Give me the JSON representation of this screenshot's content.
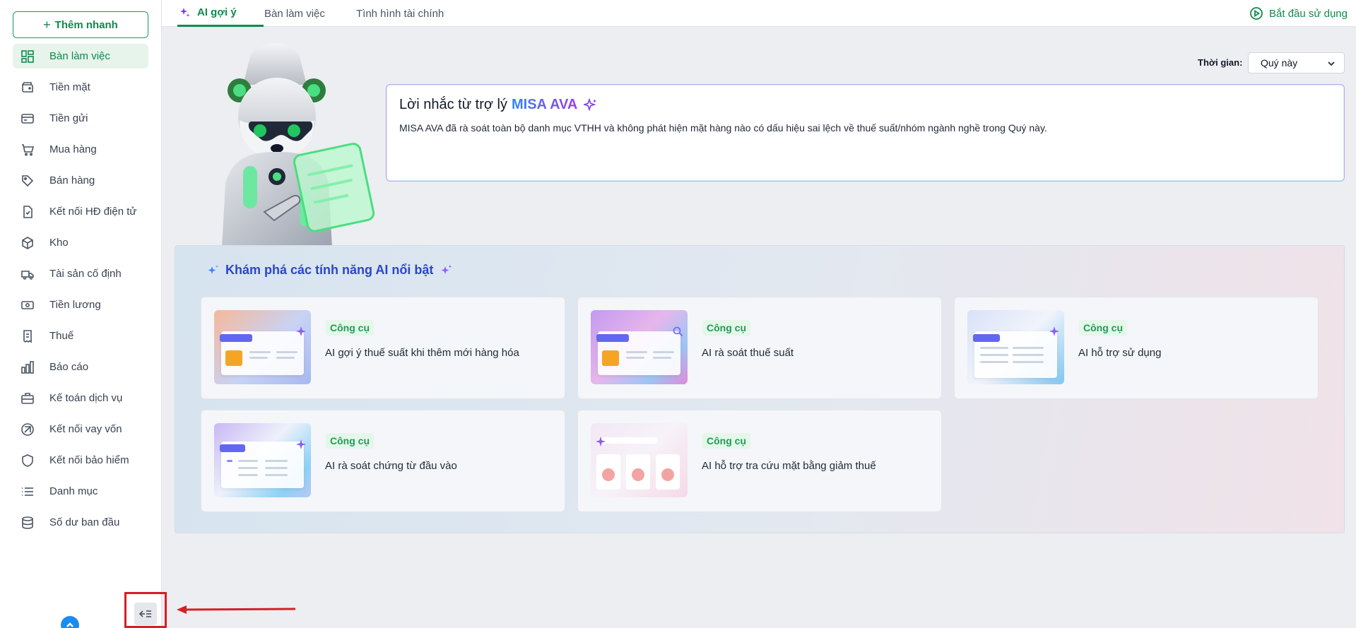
{
  "sidebar": {
    "quick_add": "Thêm nhanh",
    "items": [
      {
        "label": "Bàn làm việc",
        "icon": "dashboard-icon",
        "active": true
      },
      {
        "label": "Tiền mặt",
        "icon": "cash-icon"
      },
      {
        "label": "Tiền gửi",
        "icon": "card-icon"
      },
      {
        "label": "Mua hàng",
        "icon": "cart-icon"
      },
      {
        "label": "Bán hàng",
        "icon": "tag-icon"
      },
      {
        "label": "Kết nối HĐ điện tử",
        "icon": "invoice-icon"
      },
      {
        "label": "Kho",
        "icon": "box-icon"
      },
      {
        "label": "Tài sản cố định",
        "icon": "truck-icon"
      },
      {
        "label": "Tiền lương",
        "icon": "money-icon"
      },
      {
        "label": "Thuế",
        "icon": "receipt-icon"
      },
      {
        "label": "Báo cáo",
        "icon": "bar-chart-icon"
      },
      {
        "label": "Kế toán dịch vụ",
        "icon": "briefcase-icon"
      },
      {
        "label": "Kết nối vay vốn",
        "icon": "loan-icon"
      },
      {
        "label": "Kết nối bảo hiểm",
        "icon": "shield-icon"
      },
      {
        "label": "Danh mục",
        "icon": "list-icon"
      },
      {
        "label": "Số dư ban đầu",
        "icon": "database-icon"
      }
    ]
  },
  "tabs": [
    {
      "label": "AI gợi ý",
      "active": true
    },
    {
      "label": "Bàn làm việc"
    },
    {
      "label": "Tình hình tài chính"
    }
  ],
  "header": {
    "start_label": "Bắt đầu sử dụng"
  },
  "filter": {
    "label": "Thời gian:",
    "value": "Quý này"
  },
  "reminder": {
    "title": "Lời nhắc từ trợ lý",
    "brand": "MISA AVA",
    "text": "MISA AVA đã rà soát toàn bộ danh mục VTHH và không phát hiện mặt hàng nào có dấu hiệu sai lệch về thuế suất/nhóm ngành nghề trong Quý này."
  },
  "features": {
    "heading": "Khám phá các tính năng AI nổi bật",
    "cards": [
      {
        "tag": "Công cụ",
        "name": "AI gợi ý thuế suất khi thêm mới hàng hóa"
      },
      {
        "tag": "Công cụ",
        "name": "AI rà soát thuế suất"
      },
      {
        "tag": "Công cụ",
        "name": "AI hỗ trợ sử dụng"
      },
      {
        "tag": "Công cụ",
        "name": "AI rà soát chứng từ đầu vào"
      },
      {
        "tag": "Công cụ",
        "name": "AI hỗ trợ tra cứu mặt bằng giảm thuế"
      }
    ]
  },
  "colors": {
    "accent": "#0f8a4f",
    "brand_blue": "#2f86f6",
    "brand_purple": "#9b3bea",
    "highlight": "#d61f26"
  }
}
